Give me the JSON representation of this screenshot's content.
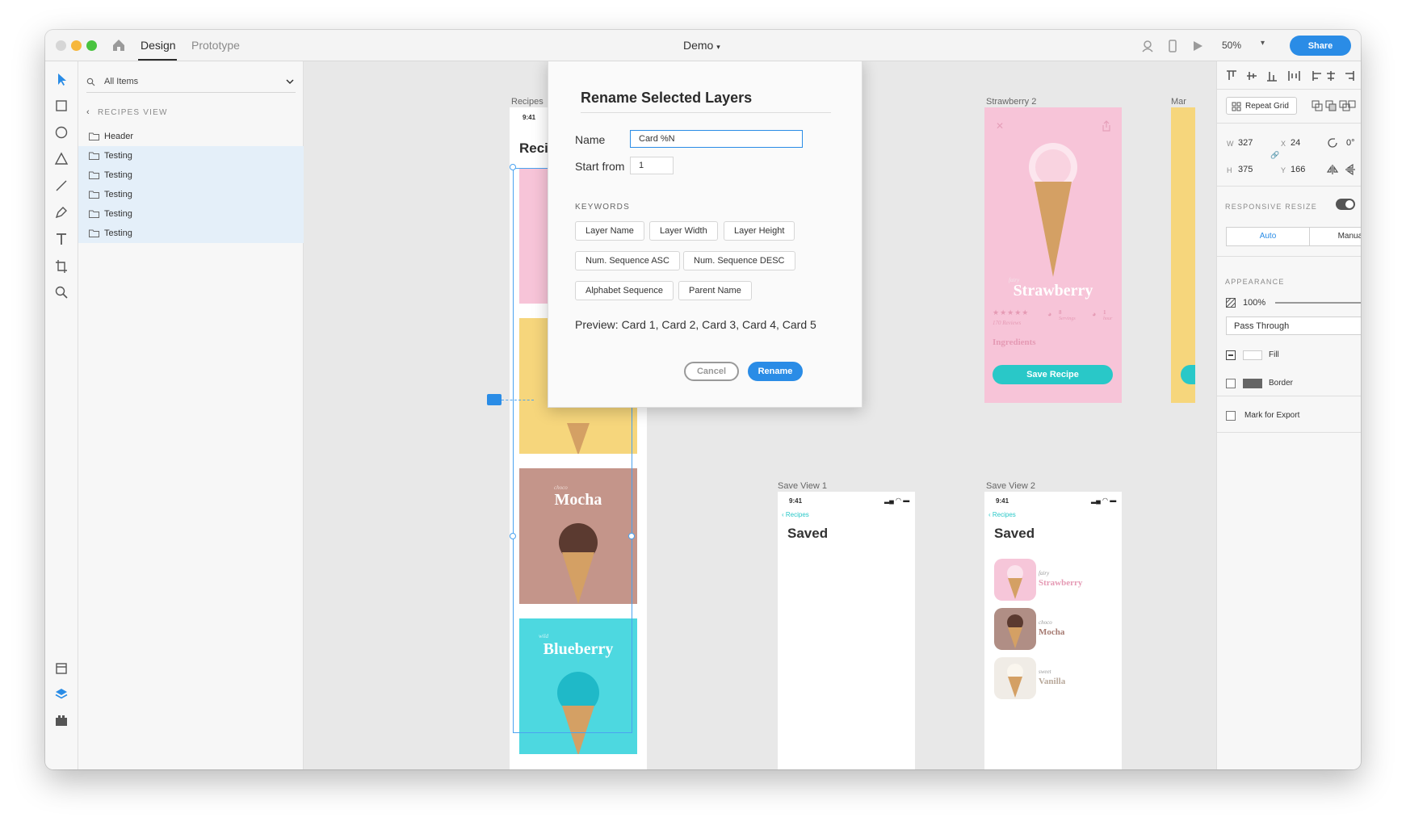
{
  "window": {
    "tabs": [
      {
        "label": "Design"
      },
      {
        "label": "Prototype"
      }
    ],
    "document_title": "Demo",
    "zoom": "50%",
    "share_label": "Share"
  },
  "layers": {
    "filter_label": "All Items",
    "back_label": "RECIPES VIEW",
    "items": [
      {
        "label": "Header",
        "selected": false
      },
      {
        "label": "Testing",
        "selected": true
      },
      {
        "label": "Testing",
        "selected": true
      },
      {
        "label": "Testing",
        "selected": true
      },
      {
        "label": "Testing",
        "selected": true
      },
      {
        "label": "Testing",
        "selected": true
      }
    ]
  },
  "canvas": {
    "artboards": {
      "recipes": {
        "label": "Recipes",
        "time": "9:41",
        "title": "Reci"
      },
      "strawberry2": {
        "label": "Strawberry 2",
        "subtitle": "fairy",
        "title": "Strawberry",
        "reviews": "170 Reviews",
        "servings_num": "8",
        "servings_lbl": "Servings",
        "hour_num": "1",
        "hour_lbl": "hour",
        "ingredients": "Ingredients",
        "save_button": "Save Recipe"
      },
      "mar": {
        "label": "Mar"
      },
      "save_view_1": {
        "label": "Save View 1",
        "time": "9:41",
        "back": "Recipes",
        "title": "Saved"
      },
      "save_view_2": {
        "label": "Save View 2",
        "time": "9:41",
        "back": "Recipes",
        "title": "Saved",
        "items": [
          {
            "subtitle": "fairy",
            "name": "Strawberry",
            "color": "#f6c6d9"
          },
          {
            "subtitle": "choco",
            "name": "Mocha",
            "color": "#b08e85"
          },
          {
            "subtitle": "sweet",
            "name": "Vanilla",
            "color": "#f0ece6"
          }
        ]
      }
    },
    "cards": [
      {
        "subtitle": "choco",
        "title": "Mocha",
        "color": "#c4958a"
      },
      {
        "subtitle": "wild",
        "title": "Blueberry",
        "color": "#4dd8e0"
      }
    ]
  },
  "dialog": {
    "title": "Rename Selected Layers",
    "name_label": "Name",
    "name_value": "Card %N",
    "start_label": "Start from",
    "start_value": "1",
    "keywords_title": "KEYWORDS",
    "keywords": [
      "Layer Name",
      "Layer Width",
      "Layer Height",
      "Num. Sequence ASC",
      "Num. Sequence DESC",
      "Alphabet Sequence",
      "Parent Name"
    ],
    "preview": "Preview: Card 1, Card 2, Card 3, Card 4, Card 5",
    "cancel": "Cancel",
    "rename": "Rename"
  },
  "properties": {
    "repeat_grid": "Repeat Grid",
    "w_label": "W",
    "w_value": "327",
    "x_label": "X",
    "x_value": "24",
    "rotation": "0°",
    "h_label": "H",
    "h_value": "375",
    "y_label": "Y",
    "y_value": "166",
    "responsive_label": "RESPONSIVE RESIZE",
    "responsive_on": true,
    "auto_label": "Auto",
    "manual_label": "Manual",
    "appearance_label": "APPEARANCE",
    "opacity": "100%",
    "blend_mode": "Pass Through",
    "fill_label": "Fill",
    "border_label": "Border",
    "export_label": "Mark for Export",
    "accent_color": "#2a8ce6"
  }
}
